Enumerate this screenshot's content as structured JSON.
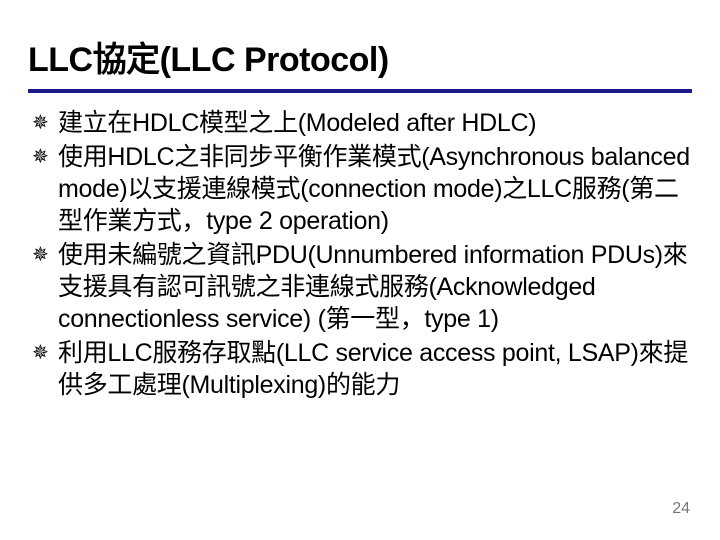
{
  "title": "LLC協定(LLC Protocol)",
  "bulletGlyph": "✵",
  "bullets": [
    "建立在HDLC模型之上(Modeled after HDLC)",
    "使用HDLC之非同步平衡作業模式(Asynchronous balanced mode)以支援連線模式(connection mode)之LLC服務(第二型作業方式，type 2 operation)",
    "使用未編號之資訊PDU(Unnumbered information PDUs)來支援具有認可訊號之非連線式服務(Acknowledged connectionless service) (第一型，type 1)",
    "利用LLC服務存取點(LLC service access point, LSAP)來提供多工處理(Multiplexing)的能力"
  ],
  "pageNumber": "24"
}
